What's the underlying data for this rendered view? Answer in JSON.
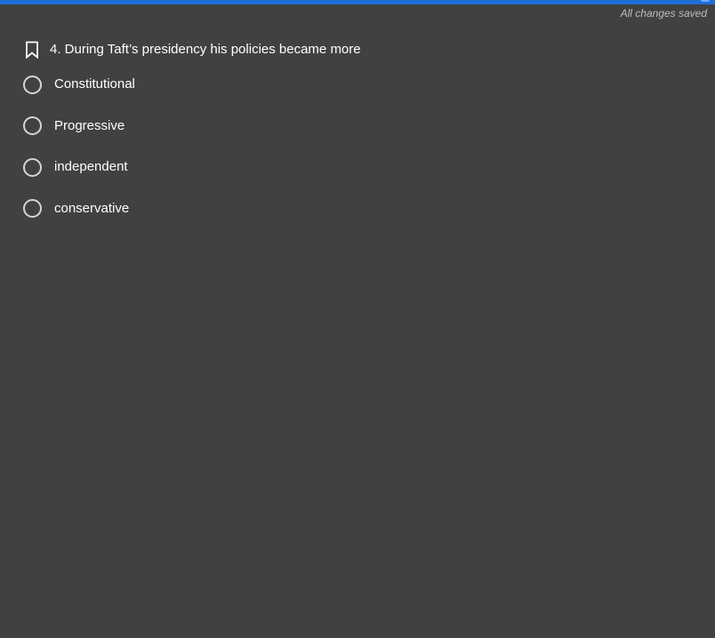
{
  "header": {
    "save_status": "All changes saved"
  },
  "question": {
    "bookmark_icon": "bookmark-icon",
    "text": "4. During Taft’s presidency his policies became more"
  },
  "choices": [
    {
      "label": "Constitutional",
      "selected": false
    },
    {
      "label": "Progressive",
      "selected": false
    },
    {
      "label": "independent",
      "selected": false
    },
    {
      "label": "conservative",
      "selected": false
    }
  ],
  "colors": {
    "background": "#414141",
    "accent_bar": "#1e6fd6",
    "save_status_text": "#bdbdbd"
  }
}
